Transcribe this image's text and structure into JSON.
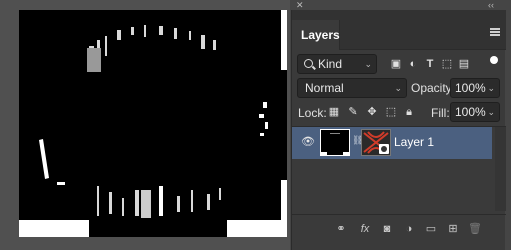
{
  "window": {
    "close_glyph": "✕",
    "collapse_glyph": "‹‹"
  },
  "panel": {
    "tab_label": "Layers",
    "menu_icon": "hamburger-icon",
    "filter": {
      "kind_value": "Kind",
      "icons": [
        "pixel-filter-icon",
        "adjustment-filter-icon",
        "type-filter-icon",
        "shape-filter-icon",
        "smart-object-filter-icon"
      ]
    },
    "blend": {
      "mode_value": "Normal",
      "opacity_label": "Opacity:",
      "opacity_value": "100%"
    },
    "lock": {
      "label": "Lock:",
      "icons": [
        "lock-transparent-icon",
        "lock-image-icon",
        "lock-position-icon",
        "lock-artboard-icon",
        "lock-all-icon"
      ],
      "fill_label": "Fill:",
      "fill_value": "100%"
    },
    "layers": [
      {
        "name": "Layer 1",
        "visible": true,
        "selected": true,
        "has_mask": true
      }
    ],
    "footer_icons": [
      "link-icon",
      "fx-icon",
      "mask-icon",
      "adjustment-icon",
      "group-icon",
      "new-layer-icon",
      "delete-icon"
    ]
  },
  "colors": {
    "selected_row": "#4b6080",
    "panel_bg": "#3a3a3a",
    "canvas_bg": "#505050"
  }
}
